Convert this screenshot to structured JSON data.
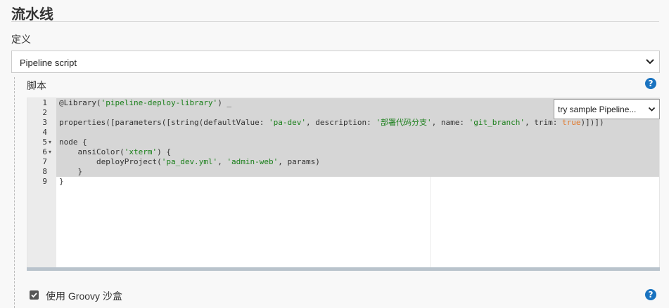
{
  "section": {
    "title": "流水线"
  },
  "definition": {
    "label": "定义",
    "selected": "Pipeline script"
  },
  "script": {
    "label": "脚本",
    "sample_select": "try sample Pipeline...",
    "line_numbers": [
      "1",
      "2",
      "3",
      "4",
      "5",
      "6",
      "7",
      "8",
      "9"
    ],
    "fold_markers": [
      "",
      "",
      "",
      "",
      "▾",
      "▾",
      "",
      "",
      ""
    ],
    "code_lines": [
      [
        {
          "t": "@Library("
        },
        {
          "t": "'pipeline-deploy-library'",
          "c": "str"
        },
        {
          "t": ") _"
        }
      ],
      [],
      [
        {
          "t": "properties([parameters([string(defaultValue: "
        },
        {
          "t": "'pa-dev'",
          "c": "str"
        },
        {
          "t": ", description: "
        },
        {
          "t": "'部署代码分支'",
          "c": "str"
        },
        {
          "t": ", name: "
        },
        {
          "t": "'git_branch'",
          "c": "str"
        },
        {
          "t": ", trim: "
        },
        {
          "t": "true",
          "c": "kw"
        },
        {
          "t": ")])])"
        }
      ],
      [],
      [
        {
          "t": "node {"
        }
      ],
      [
        {
          "t": "    ansiColor("
        },
        {
          "t": "'xterm'",
          "c": "str"
        },
        {
          "t": ") {"
        }
      ],
      [
        {
          "t": "        deployProject("
        },
        {
          "t": "'pa_dev.yml'",
          "c": "str"
        },
        {
          "t": ", "
        },
        {
          "t": "'admin-web'",
          "c": "str"
        },
        {
          "t": ", params)"
        }
      ],
      [
        {
          "t": "    }"
        }
      ],
      [
        {
          "t": "}"
        }
      ]
    ]
  },
  "sandbox": {
    "label": "使用 Groovy 沙盒",
    "checked": true
  },
  "help": {
    "glyph": "?"
  },
  "icons": {
    "select_chevron": "chevron-down-icon",
    "help": "help-icon",
    "checkbox": "checkmark-icon"
  },
  "colors": {
    "string": "#1a7f1a",
    "keyword": "#e07a2e",
    "help": "#1a73c0"
  }
}
